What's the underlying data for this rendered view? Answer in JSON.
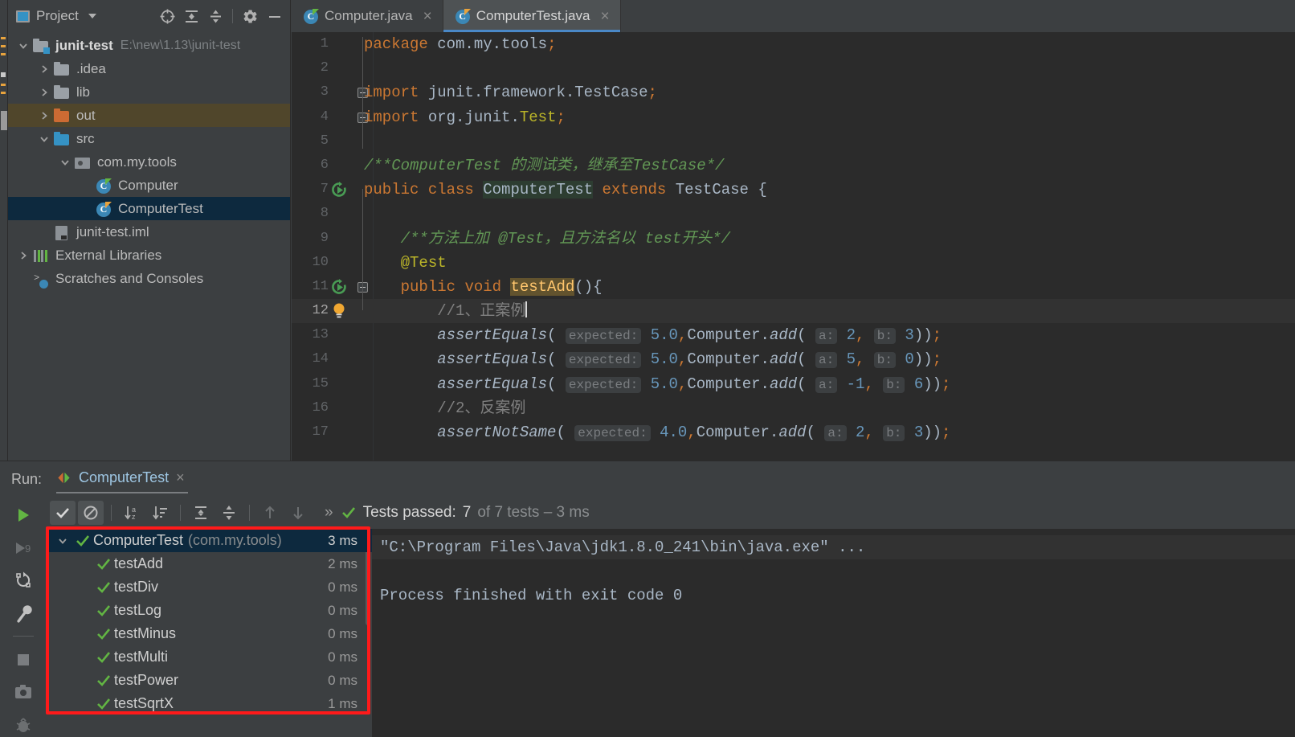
{
  "project_panel": {
    "title": "Project",
    "icons": [
      "project-window-icon",
      "locate-icon",
      "expand-all-icon",
      "collapse-all-icon",
      "settings-gear-icon",
      "minimize-icon"
    ],
    "tree": [
      {
        "label": "junit-test",
        "path": "E:\\new\\1.13\\junit-test",
        "icon": "module-folder-icon",
        "indent": 0,
        "twisty": "expanded",
        "bold": true,
        "state": "normal"
      },
      {
        "label": ".idea",
        "path": "",
        "icon": "folder-icon",
        "indent": 1,
        "twisty": "collapsed",
        "bold": false,
        "state": "normal"
      },
      {
        "label": "lib",
        "path": "",
        "icon": "folder-icon",
        "indent": 1,
        "twisty": "collapsed",
        "bold": false,
        "state": "normal"
      },
      {
        "label": "out",
        "path": "",
        "icon": "folder-excluded-icon",
        "indent": 1,
        "twisty": "collapsed",
        "bold": false,
        "state": "olive"
      },
      {
        "label": "src",
        "path": "",
        "icon": "folder-source-icon",
        "indent": 1,
        "twisty": "expanded",
        "bold": false,
        "state": "normal"
      },
      {
        "label": "com.my.tools",
        "path": "",
        "icon": "package-icon",
        "indent": 2,
        "twisty": "expanded",
        "bold": false,
        "state": "normal"
      },
      {
        "label": "Computer",
        "path": "",
        "icon": "java-class-icon",
        "indent": 3,
        "twisty": "none",
        "bold": false,
        "state": "normal"
      },
      {
        "label": "ComputerTest",
        "path": "",
        "icon": "java-test-class-icon",
        "indent": 3,
        "twisty": "none",
        "bold": false,
        "state": "selected"
      },
      {
        "label": "junit-test.iml",
        "path": "",
        "icon": "iml-file-icon",
        "indent": 1,
        "twisty": "none",
        "bold": false,
        "state": "normal"
      },
      {
        "label": "External Libraries",
        "path": "",
        "icon": "libraries-icon",
        "indent": 0,
        "twisty": "collapsed",
        "bold": false,
        "state": "normal"
      },
      {
        "label": "Scratches and Consoles",
        "path": "",
        "icon": "scratches-icon",
        "indent": 0,
        "twisty": "none",
        "bold": false,
        "state": "normal"
      }
    ]
  },
  "editor": {
    "tabs": [
      {
        "label": "Computer.java",
        "icon": "java-class-icon",
        "active": false
      },
      {
        "label": "ComputerTest.java",
        "icon": "java-test-class-icon",
        "active": true
      }
    ],
    "close_glyph": "×",
    "current_line": 12,
    "lines": [
      {
        "n": "1",
        "gutter": "",
        "fold": "",
        "html": "<span class=\"k\">package</span> com.my.tools<span class=\"comma\">;</span>"
      },
      {
        "n": "2",
        "gutter": "",
        "fold": "",
        "html": ""
      },
      {
        "n": "3",
        "gutter": "",
        "fold": "fold-box",
        "html": "<span class=\"k\">import</span> junit.framework.TestCase<span class=\"comma\">;</span>"
      },
      {
        "n": "4",
        "gutter": "",
        "fold": "fold-box",
        "html": "<span class=\"k\">import</span> org.junit.<span class=\"an\">Test</span><span class=\"comma\">;</span>"
      },
      {
        "n": "5",
        "gutter": "",
        "fold": "",
        "html": ""
      },
      {
        "n": "6",
        "gutter": "",
        "fold": "",
        "html": "<span class=\"cm\">/**ComputerTest 的测试类，继承至TestCase*/</span>"
      },
      {
        "n": "7",
        "gutter": "run-test-icon",
        "fold": "",
        "html": "<span class=\"k\">public</span> <span class=\"k\">class</span> <span class=\"hl-ident\">ComputerTest</span> <span class=\"k\">extends</span> TestCase {"
      },
      {
        "n": "8",
        "gutter": "",
        "fold": "",
        "html": ""
      },
      {
        "n": "9",
        "gutter": "",
        "fold": "",
        "html": "    <span class=\"cm\">/**方法上加 @Test，且方法名以 test开头*/</span>"
      },
      {
        "n": "10",
        "gutter": "",
        "fold": "",
        "html": "    <span class=\"an\">@Test</span>"
      },
      {
        "n": "11",
        "gutter": "run-test-icon",
        "fold": "fold-box",
        "html": "    <span class=\"k\">public</span> <span class=\"k\">void</span> <span class=\"hl-method\">testAdd</span>(){"
      },
      {
        "n": "12",
        "gutter": "intention-bulb-icon",
        "fold": "",
        "html": "        <span class=\"lc\">//1、正案例</span><span class=\"caret\"></span>"
      },
      {
        "n": "13",
        "gutter": "",
        "fold": "",
        "html": "        <span class=\"mth\">assertEquals</span>( <span class=\"hint\">expected:</span> <span class=\"num\">5.0</span><span class=\"comma\">,</span>Computer.<span class=\"mth\">add</span>( <span class=\"hint\">a:</span> <span class=\"num\">2</span><span class=\"comma\">,</span> <span class=\"hint\">b:</span> <span class=\"num\">3</span>))<span class=\"comma\">;</span>"
      },
      {
        "n": "14",
        "gutter": "",
        "fold": "",
        "html": "        <span class=\"mth\">assertEquals</span>( <span class=\"hint\">expected:</span> <span class=\"num\">5.0</span><span class=\"comma\">,</span>Computer.<span class=\"mth\">add</span>( <span class=\"hint\">a:</span> <span class=\"num\">5</span><span class=\"comma\">,</span> <span class=\"hint\">b:</span> <span class=\"num\">0</span>))<span class=\"comma\">;</span>"
      },
      {
        "n": "15",
        "gutter": "",
        "fold": "",
        "html": "        <span class=\"mth\">assertEquals</span>( <span class=\"hint\">expected:</span> <span class=\"num\">5.0</span><span class=\"comma\">,</span>Computer.<span class=\"mth\">add</span>( <span class=\"hint\">a:</span> <span class=\"num\">-1</span><span class=\"comma\">,</span> <span class=\"hint\">b:</span> <span class=\"num\">6</span>))<span class=\"comma\">;</span>"
      },
      {
        "n": "16",
        "gutter": "",
        "fold": "",
        "html": "        <span class=\"lc\">//2、反案例</span>"
      },
      {
        "n": "17",
        "gutter": "",
        "fold": "",
        "html": "        <span class=\"mth\">assertNotSame</span>( <span class=\"hint\">expected:</span> <span class=\"num\">4.0</span><span class=\"comma\">,</span>Computer.<span class=\"mth\">add</span>( <span class=\"hint\">a:</span> <span class=\"num\">2</span><span class=\"comma\">,</span> <span class=\"hint\">b:</span> <span class=\"num\">3</span>))<span class=\"comma\">;</span>"
      }
    ]
  },
  "run_panel": {
    "label": "Run:",
    "tab_name": "ComputerTest",
    "tab_close": "×",
    "sidebar_icons": [
      "rerun-icon",
      "rerun-failed-tests-icon",
      "restart-icon",
      "settings-wrench-icon",
      "stop-icon",
      "screenshot-icon",
      "debug-icon"
    ],
    "toolbar_icons": [
      "show-passed-icon",
      "hide-ignored-icon",
      "sort-alphabetically-icon",
      "sort-by-duration-icon",
      "expand-all-icon",
      "collapse-all-icon",
      "prev-test-icon",
      "next-test-icon"
    ],
    "more_glyph": "»",
    "status": {
      "prefix": "Tests passed:",
      "count": "7",
      "suffix": "of 7 tests – 3 ms"
    },
    "results": [
      {
        "label": "ComputerTest",
        "pkg": "(com.my.tools)",
        "time": "3 ms",
        "level": 0,
        "selected": true,
        "twisty": "expanded"
      },
      {
        "label": "testAdd",
        "pkg": "",
        "time": "2 ms",
        "level": 1,
        "selected": false,
        "twisty": "none"
      },
      {
        "label": "testDiv",
        "pkg": "",
        "time": "0 ms",
        "level": 1,
        "selected": false,
        "twisty": "none"
      },
      {
        "label": "testLog",
        "pkg": "",
        "time": "0 ms",
        "level": 1,
        "selected": false,
        "twisty": "none"
      },
      {
        "label": "testMinus",
        "pkg": "",
        "time": "0 ms",
        "level": 1,
        "selected": false,
        "twisty": "none"
      },
      {
        "label": "testMulti",
        "pkg": "",
        "time": "0 ms",
        "level": 1,
        "selected": false,
        "twisty": "none"
      },
      {
        "label": "testPower",
        "pkg": "",
        "time": "0 ms",
        "level": 1,
        "selected": false,
        "twisty": "none"
      },
      {
        "label": "testSqrtX",
        "pkg": "",
        "time": "1 ms",
        "level": 1,
        "selected": false,
        "twisty": "none"
      }
    ],
    "console": [
      {
        "text": "\"C:\\Program Files\\Java\\jdk1.8.0_241\\bin\\java.exe\" ...",
        "highlight": true
      },
      {
        "text": "",
        "highlight": false
      },
      {
        "text": "Process finished with exit code 0",
        "highlight": false
      }
    ]
  },
  "annotations": {
    "highlight_color": "#ff1a1a"
  }
}
